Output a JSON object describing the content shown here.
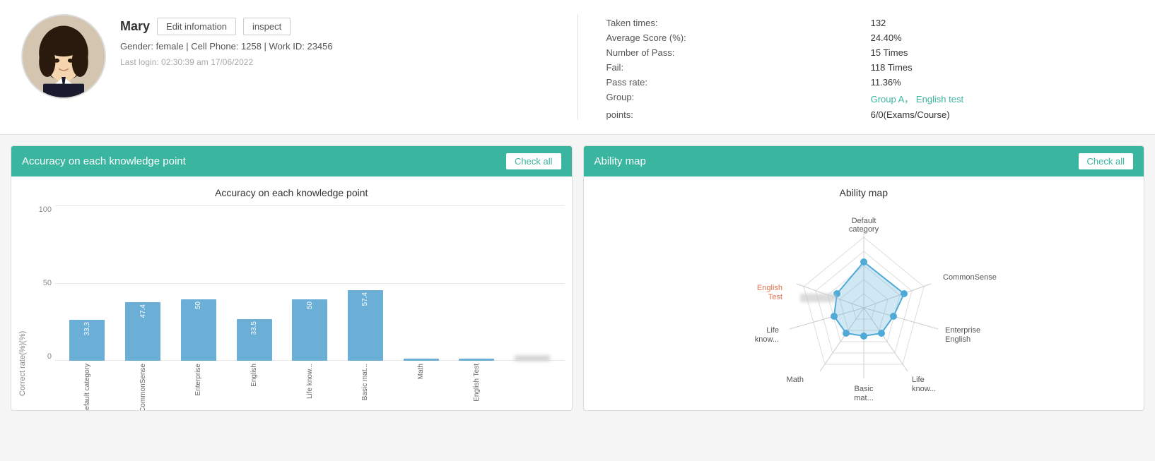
{
  "user": {
    "name": "Mary",
    "edit_btn": "Edit infomation",
    "inspect_btn": "inspect",
    "gender": "female",
    "cell_phone": "1258",
    "work_id": "23456",
    "last_login": "Last login:  02:30:39 am 17/06/2022",
    "meta_line": "Gender:  female  |  Cell Phone:  1258  |  Work ID:  23456"
  },
  "stats": {
    "taken_times_label": "Taken times:",
    "taken_times_value": "132",
    "avg_score_label": "Average Score (%):",
    "avg_score_value": "24.40%",
    "num_pass_label": "Number of Pass:",
    "num_pass_value": "15 Times",
    "fail_label": "Fail:",
    "fail_value": "118 Times",
    "pass_rate_label": "Pass rate:",
    "pass_rate_value": "11.36%",
    "group_label": "Group:",
    "group_value": "Group A，  English test",
    "points_label": "points:",
    "points_value": "6/0(Exams/Course)"
  },
  "knowledge_chart": {
    "title": "Accuracy on each knowledge point",
    "header_title": "Accuracy on each knowledge point",
    "check_all": "Check all",
    "y_label": "Correct rate(%)(%) ",
    "bars": [
      {
        "label": "Default category",
        "value": 33.3,
        "height_pct": 33.3
      },
      {
        "label": "CommonSense",
        "value": 47.4,
        "height_pct": 47.4
      },
      {
        "label": "Enterprise",
        "value": 50.0,
        "height_pct": 50.0
      },
      {
        "label": "English",
        "value": 33.5,
        "height_pct": 33.5
      },
      {
        "label": "Life know...",
        "value": 50.0,
        "height_pct": 50.0
      },
      {
        "label": "Basic mat...",
        "value": 57.4,
        "height_pct": 57.4
      },
      {
        "label": "Math",
        "value": null,
        "height_pct": 1
      },
      {
        "label": "English Test",
        "value": null,
        "height_pct": 1
      },
      {
        "label": "",
        "value": null,
        "height_pct": 4,
        "blurred": true
      }
    ],
    "y_ticks": [
      "100",
      "50",
      "0"
    ]
  },
  "ability_chart": {
    "header_title": "Ability map",
    "check_all": "Check all",
    "title": "Ability map",
    "labels": [
      "Default category",
      "CommonSense",
      "Enterprise",
      "English",
      "Life know...",
      "Basic mat...",
      "Math",
      "Life know...",
      "English Test"
    ]
  }
}
